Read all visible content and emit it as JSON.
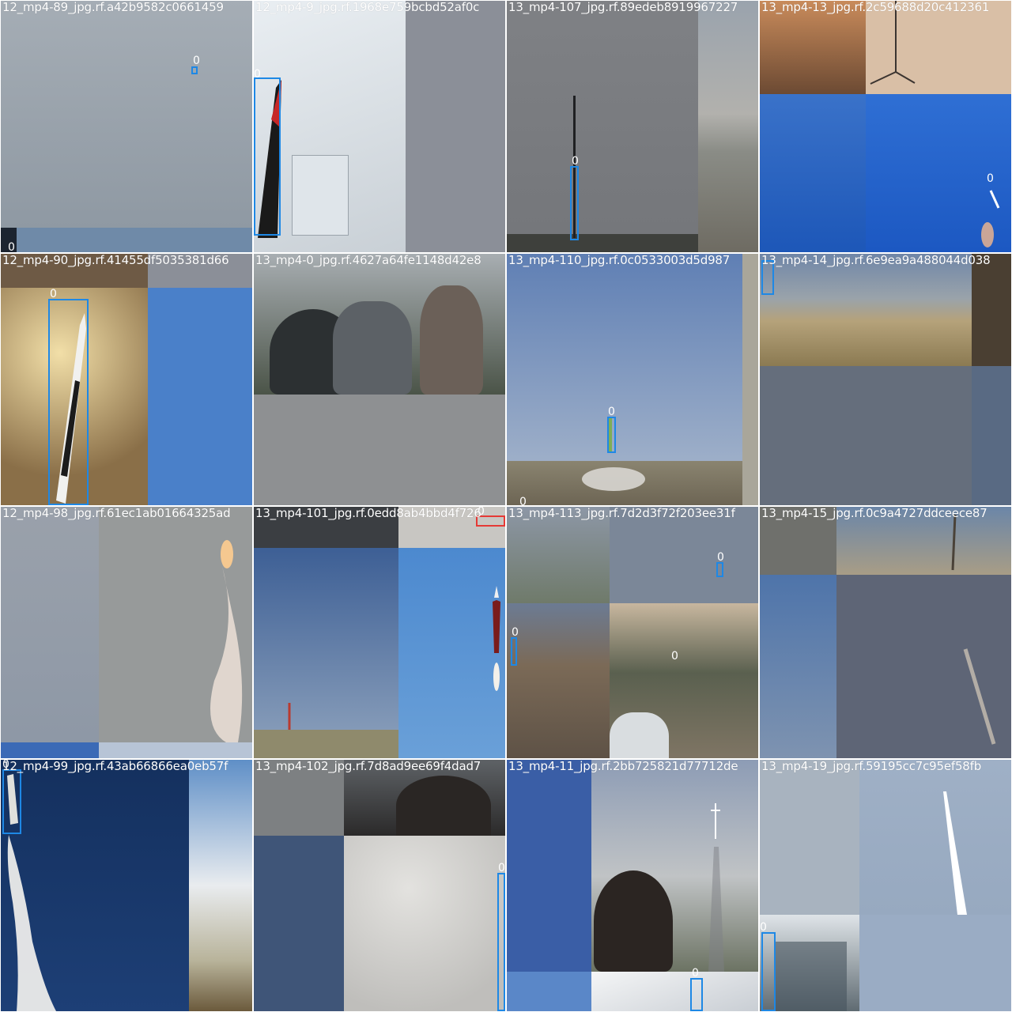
{
  "tiles": [
    {
      "label": "12_mp4-89_jpg.rf.a42b9582c0661459"
    },
    {
      "label": "12_mp4-9_jpg.rf.1968e759bcbd52af0c"
    },
    {
      "label": "13_mp4-107_jpg.rf.89edeb8919967227"
    },
    {
      "label": "13_mp4-13_jpg.rf.2c59688d20c412361"
    },
    {
      "label": "12_mp4-90_jpg.rf.41455df5035381d66"
    },
    {
      "label": "13_mp4-0_jpg.rf.4627a64fe1148d42e8"
    },
    {
      "label": "13_mp4-110_jpg.rf.0c0533003d5d987"
    },
    {
      "label": "13_mp4-14_jpg.rf.6e9ea9a488044d038"
    },
    {
      "label": "12_mp4-98_jpg.rf.61ec1ab01664325ad"
    },
    {
      "label": "13_mp4-101_jpg.rf.0edd8ab4bbd4f726"
    },
    {
      "label": "13_mp4-113_jpg.rf.7d2d3f72f203ee31f"
    },
    {
      "label": "13_mp4-15_jpg.rf.0c9a4727ddceece87"
    },
    {
      "label": "12_mp4-99_jpg.rf.43ab66866ea0eb57f"
    },
    {
      "label": "13_mp4-102_jpg.rf.7d8ad9ee69f4dad7"
    },
    {
      "label": "13_mp4-11_jpg.rf.2bb725821d77712de"
    },
    {
      "label": "13_mp4-19_jpg.rf.59195cc7c95ef58fb"
    }
  ],
  "box_class": "0",
  "colors": {
    "bbox": "#1e88e5",
    "label_text": "#ffffff"
  }
}
